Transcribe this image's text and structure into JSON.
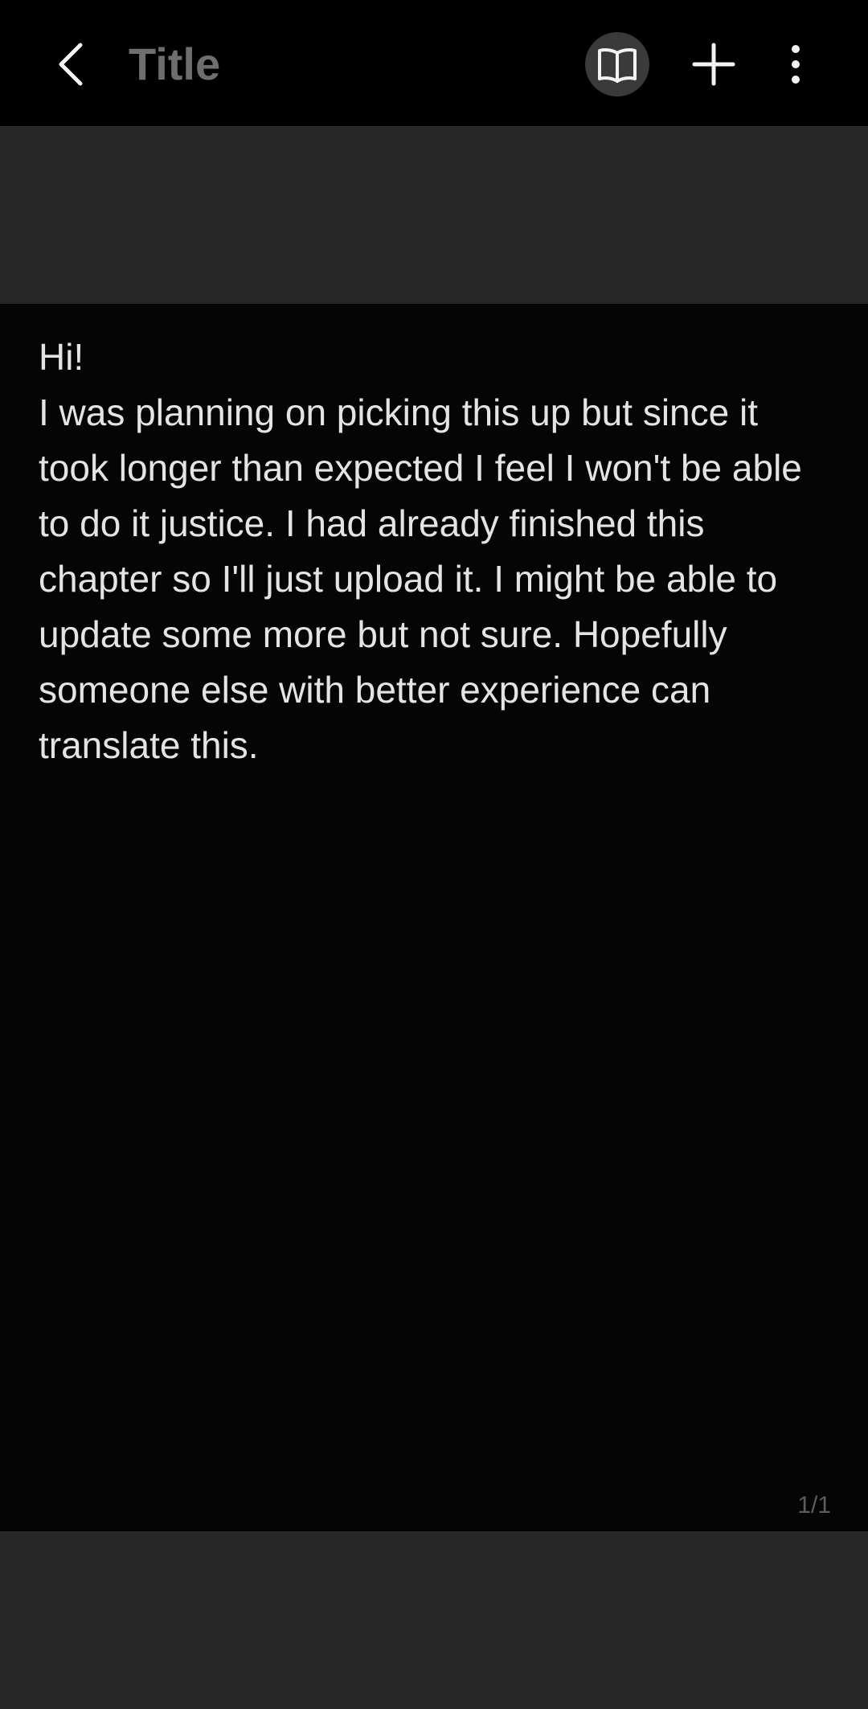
{
  "header": {
    "title": "Title",
    "back_icon": "chevron-left-icon",
    "read_mode_icon": "open-book-icon",
    "add_icon": "plus-icon",
    "more_icon": "more-vertical-icon"
  },
  "note": {
    "text": "Hi!\nI was planning on picking this up but since it took longer than expected I feel I won't be able to do it justice. I had already finished this chapter so I'll just upload it. I might be able to update some more but not sure. Hopefully someone else with better experience can translate this.",
    "page_indicator": "1/1"
  },
  "colors": {
    "background": "#000000",
    "band": "#262626",
    "title": "#6e6e6e",
    "text": "#e4e4e4",
    "read_mode_circle": "#3a3a3a"
  }
}
